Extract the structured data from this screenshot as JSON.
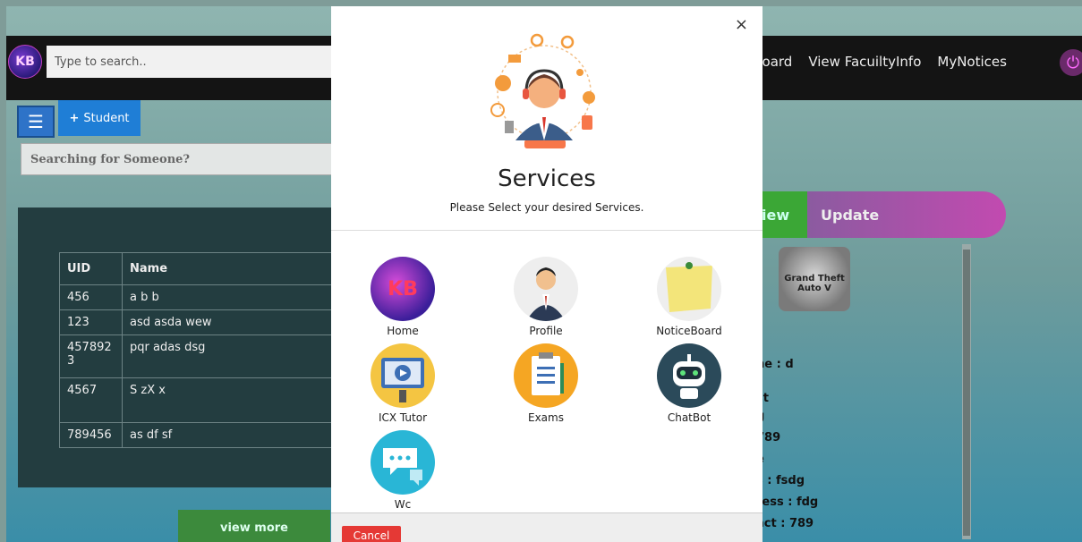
{
  "app": {
    "logo_text": "KB",
    "search_placeholder": "Type to search..",
    "nav": [
      "board",
      "View FacuiltyInfo",
      "MyNotices"
    ]
  },
  "toolbar": {
    "student_label": "Student",
    "searching_placeholder": "Searching for Someone?"
  },
  "table": {
    "headers": [
      "UID",
      "Name"
    ],
    "rows": [
      [
        "456",
        "a b b"
      ],
      [
        "123",
        "asd asda wew"
      ],
      [
        "4578923",
        "pqr adas dsg"
      ],
      [
        "4567",
        "S zX x"
      ],
      [
        "789456",
        "as df sf"
      ]
    ],
    "view_more": "view more"
  },
  "detail": {
    "tab_view": "iew",
    "tab_update": "Update",
    "logo_text": "Grand Theft Auto V",
    "lines": [
      "ne : d",
      "st",
      "g",
      "789",
      "e",
      "s : fsdg",
      "ress : fdg",
      "act : 789"
    ]
  },
  "modal": {
    "close": "×",
    "title": "Services",
    "subtitle": "Please Select your desired Services.",
    "services": [
      {
        "label": "Home",
        "icon": "kb-logo-icon"
      },
      {
        "label": "Profile",
        "icon": "person-icon"
      },
      {
        "label": "NoticeBoard",
        "icon": "sticky-note-icon"
      },
      {
        "label": "ICX Tutor",
        "icon": "tutor-icon"
      },
      {
        "label": "Exams",
        "icon": "exam-clipboard-icon"
      },
      {
        "label": "ChatBot",
        "icon": "robot-icon"
      },
      {
        "label": "Wc",
        "icon": "chat-bubble-icon"
      }
    ],
    "cancel": "Cancel"
  },
  "colors": {
    "topbar": "#141414",
    "primary_blue": "#1f7ed6",
    "cancel_red": "#e53935",
    "view_green": "#3ba736",
    "update_purple": "#c24ab0"
  }
}
